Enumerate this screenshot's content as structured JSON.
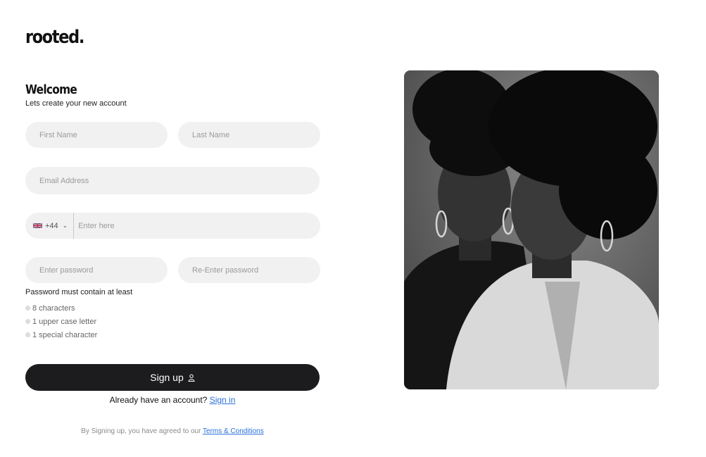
{
  "brand": {
    "logo": "rooted."
  },
  "welcome": {
    "title": "Welcome",
    "subtitle": "Lets create your new account"
  },
  "form": {
    "first_name_placeholder": "First Name",
    "last_name_placeholder": "Last Name",
    "email_placeholder": "Email Address",
    "phone_code": "+44",
    "phone_placeholder": "Enter here",
    "password_placeholder": "Enter password",
    "reenter_placeholder": "Re-Enter password"
  },
  "password_rules": {
    "title": "Password must contain at least",
    "items": [
      "8 characters",
      "1 upper case letter",
      "1 special character"
    ]
  },
  "signup": {
    "label": "Sign up"
  },
  "signin": {
    "prompt": "Already have an account?",
    "link": "Sign in"
  },
  "terms": {
    "prefix": "By Signing up, you have agreed to our",
    "link": "Terms & Conditions"
  },
  "colors": {
    "accent_link": "#2a6fdb",
    "button": "#1c1c1e",
    "field_bg": "#f1f1f1"
  },
  "icons": {
    "signup": "user-icon",
    "country": "uk-flag-icon",
    "dropdown": "chevron-down-icon"
  }
}
